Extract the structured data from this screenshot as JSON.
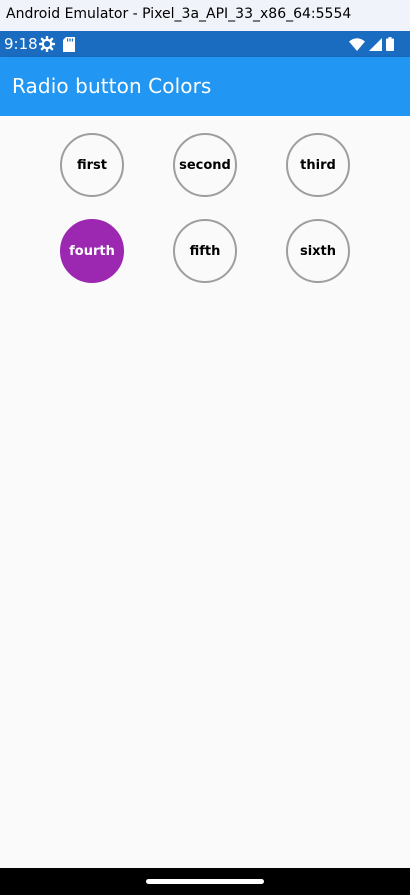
{
  "window": {
    "title": "Android Emulator - Pixel_3a_API_33_x86_64:5554"
  },
  "status_bar": {
    "time": "9:18",
    "background": "#1a6cc0",
    "icons_left": [
      "settings-gear-icon",
      "sd-card-icon"
    ],
    "icons_right": [
      "wifi-icon",
      "cell-signal-icon",
      "battery-icon"
    ]
  },
  "app_bar": {
    "title": "Radio button Colors",
    "background": "#2196f3"
  },
  "radio_group": {
    "selected": "fourth",
    "selected_color": "#9c27b0",
    "unselected_border_color": "#9e9e9e",
    "options": [
      {
        "label": "first",
        "selected": false
      },
      {
        "label": "second",
        "selected": false
      },
      {
        "label": "third",
        "selected": false
      },
      {
        "label": "fourth",
        "selected": true
      },
      {
        "label": "fifth",
        "selected": false
      },
      {
        "label": "sixth",
        "selected": false
      }
    ]
  },
  "nav_bar": {
    "background": "#000000",
    "handle": "home-gesture-handle"
  }
}
